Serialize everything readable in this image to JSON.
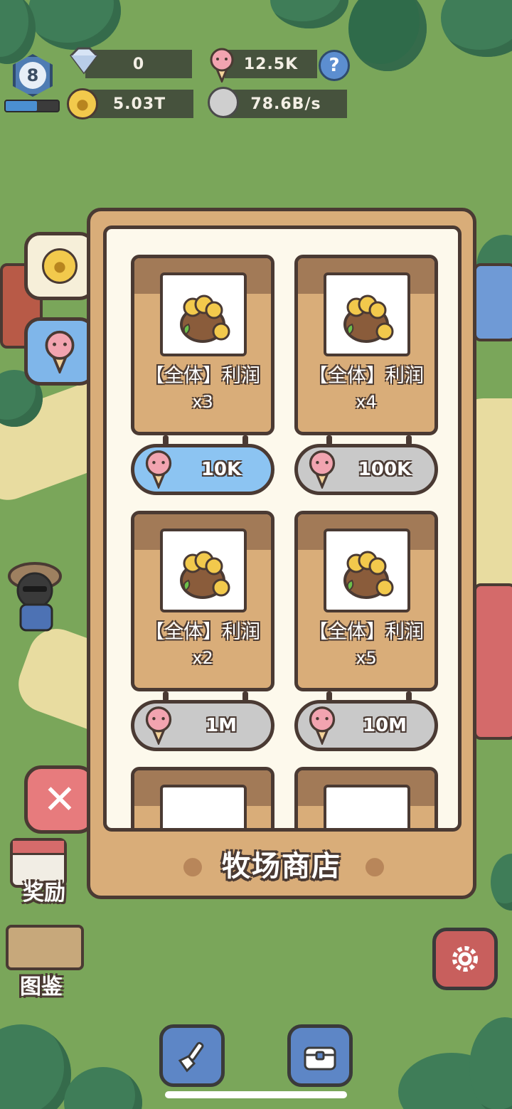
{
  "hud": {
    "level": "8",
    "xp_progress": 0.6,
    "gems": "0",
    "ice_cream_currency": "12.5K",
    "coins": "5.03T",
    "income_rate": "78.6B/s",
    "help_label": "?"
  },
  "side_tabs": {
    "coin_icon": "paw-coin-icon",
    "ice_cream_icon": "ice-cream-icon",
    "close_label": "✕"
  },
  "shop": {
    "title": "牧场商店",
    "items": [
      {
        "name": "【全体】利润",
        "multiplier": "x3",
        "price": "10K",
        "affordable": true
      },
      {
        "name": "【全体】利润",
        "multiplier": "x4",
        "price": "100K",
        "affordable": false
      },
      {
        "name": "【全体】利润",
        "multiplier": "x2",
        "price": "1M",
        "affordable": false
      },
      {
        "name": "【全体】利润",
        "multiplier": "x5",
        "price": "10M",
        "affordable": false
      }
    ]
  },
  "left_buttons": {
    "rewards_label": "奖励",
    "collection_label": "图鉴"
  },
  "colors": {
    "panel": "#d9ad79",
    "panel_inner": "#fdf9ec",
    "outline": "#4a3a33",
    "active_button": "#8cc4f2",
    "inactive_button": "#c9c9c9"
  }
}
